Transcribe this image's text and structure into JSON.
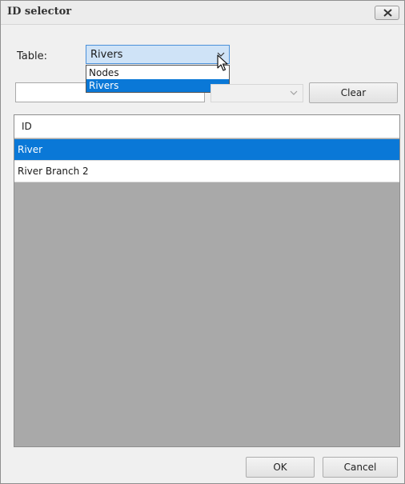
{
  "window": {
    "title": "ID selector"
  },
  "filter": {
    "table_label": "Table:",
    "table_selected": "Rivers",
    "table_options": [
      "Nodes",
      "Rivers"
    ],
    "text_value": "",
    "secondary_select_value": "",
    "clear_label": "Clear"
  },
  "grid": {
    "header": "ID",
    "rows": [
      "River",
      "River Branch 2"
    ],
    "selected_row": 0
  },
  "footer": {
    "ok_label": "OK",
    "cancel_label": "Cancel"
  },
  "icons": {
    "close": "close-icon",
    "dropdown": "chevron-down-icon",
    "cursor": "mouse-pointer-icon"
  },
  "colors": {
    "selection": "#0a78d7",
    "grid_background": "#a9a9a9"
  }
}
